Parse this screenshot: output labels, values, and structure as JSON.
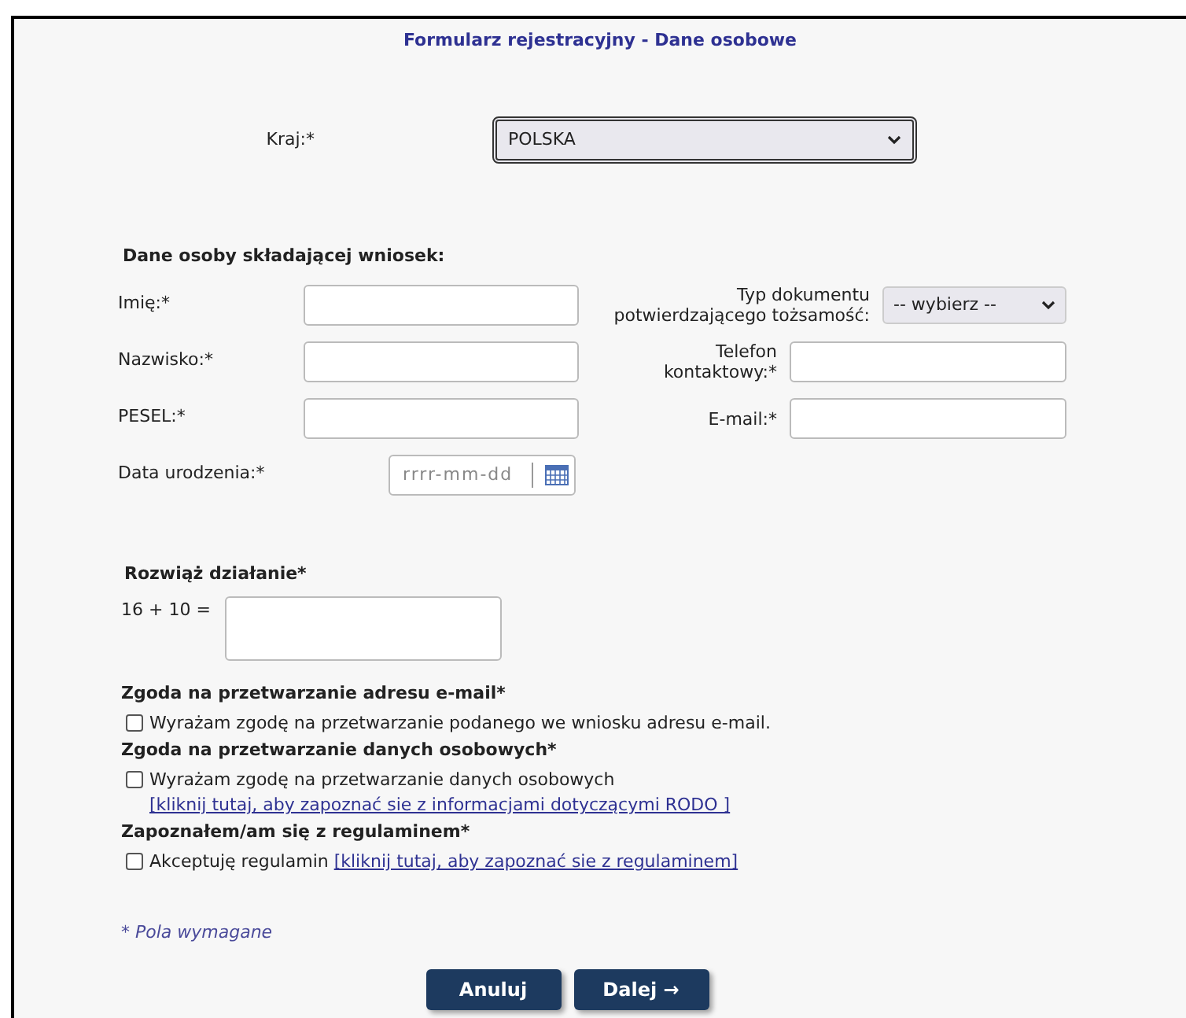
{
  "title": "Formularz rejestracyjny - Dane osobowe",
  "country": {
    "label": "Kraj:*",
    "value": "POLSKA"
  },
  "applicant": {
    "heading": "Dane osoby składającej wniosek:",
    "left_fields": [
      {
        "label": "Imię:*",
        "kind": "text"
      },
      {
        "label": "Nazwisko:*",
        "kind": "text"
      },
      {
        "label": "PESEL:*",
        "kind": "text"
      },
      {
        "label": "Data urodzenia:*",
        "kind": "date",
        "placeholder": "rrrr-mm-dd"
      }
    ],
    "right_fields": [
      {
        "label": "Typ dokumentu potwierdzającego tożsamość:",
        "kind": "select",
        "value": "-- wybierz --"
      },
      {
        "label": "Telefon kontaktowy:*",
        "kind": "text"
      },
      {
        "label": "E-mail:*",
        "kind": "text"
      }
    ]
  },
  "captcha": {
    "heading": "Rozwiąż działanie*",
    "question": "16 + 10 ="
  },
  "consents": [
    {
      "heading": "Zgoda na przetwarzanie adresu e-mail*",
      "text": "Wyrażam zgodę na przetwarzanie podanego we wniosku adresu e-mail.",
      "checked": false
    },
    {
      "heading": "Zgoda na przetwarzanie danych osobowych*",
      "text": "Wyrażam zgodę na przetwarzanie danych osobowych",
      "link": "[kliknij tutaj, aby zapoznać sie z informacjami dotyczącymi RODO ]",
      "checked": false
    },
    {
      "heading": "Zapoznałem/am się z regulaminem*",
      "text": "Akceptuję regulamin",
      "link": "[kliknij tutaj, aby zapoznać sie z regulaminem]",
      "checked": false
    }
  ],
  "required_note": "* Pola wymagane",
  "buttons": [
    "Anuluj",
    "Dalej →"
  ]
}
